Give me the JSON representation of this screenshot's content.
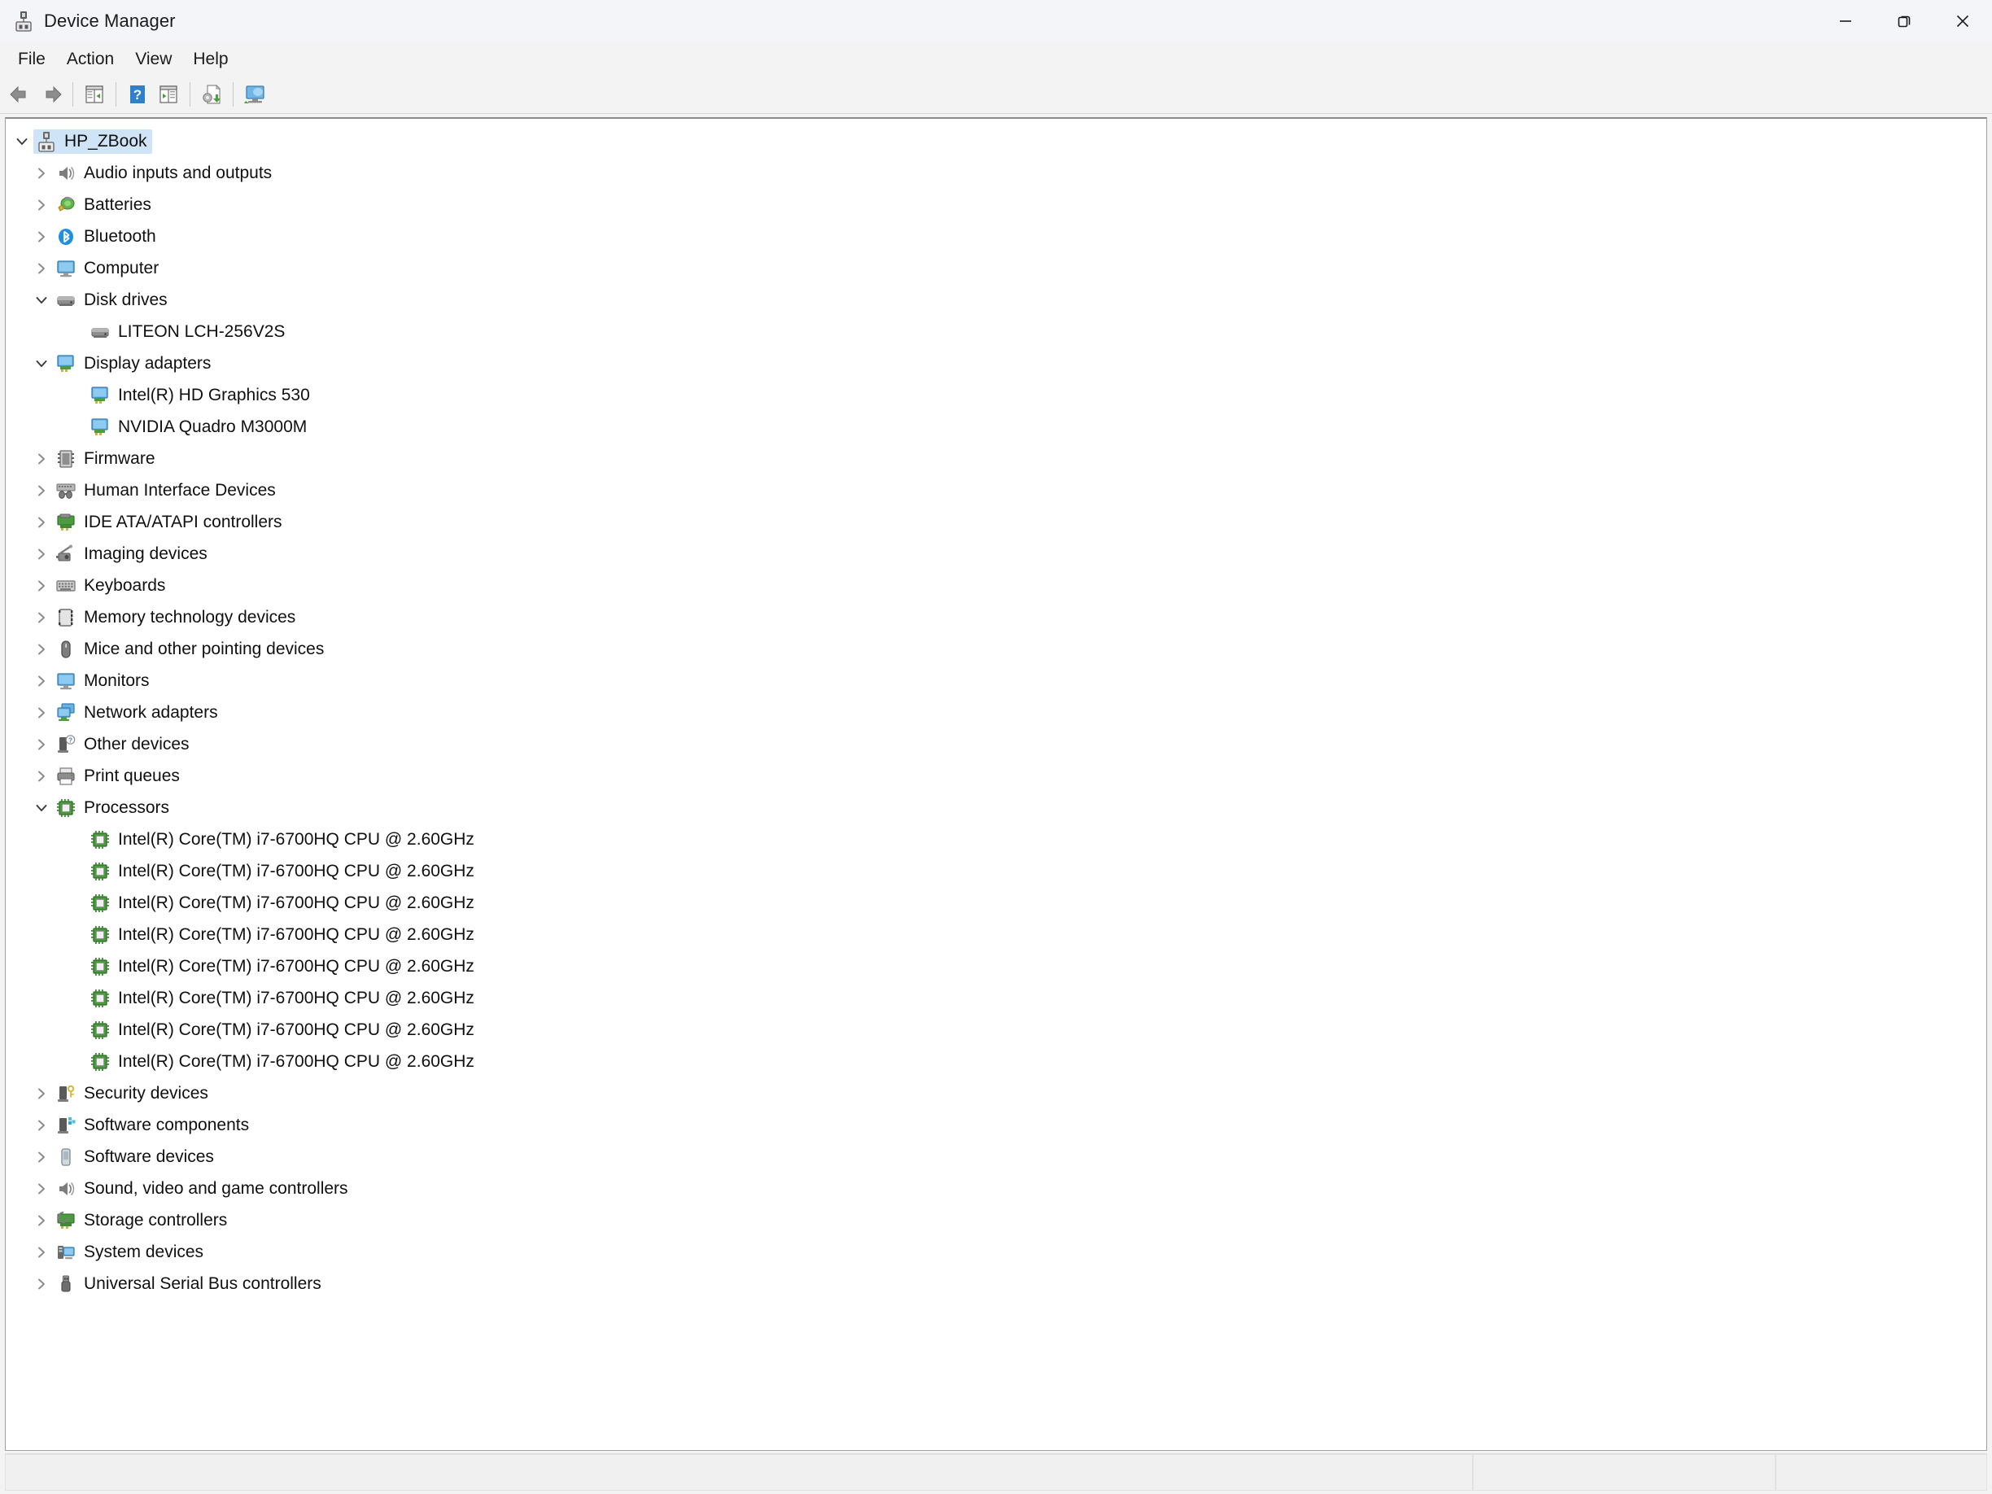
{
  "window": {
    "title": "Device Manager",
    "app_icon": "device-manager-icon",
    "controls": [
      {
        "name": "minimize",
        "glyph": "minimize-icon"
      },
      {
        "name": "restore",
        "glyph": "restore-icon"
      },
      {
        "name": "close",
        "glyph": "close-icon"
      }
    ]
  },
  "menubar": {
    "items": [
      {
        "label": "File",
        "name": "menu-file"
      },
      {
        "label": "Action",
        "name": "menu-action"
      },
      {
        "label": "View",
        "name": "menu-view"
      },
      {
        "label": "Help",
        "name": "menu-help"
      }
    ]
  },
  "toolbar": {
    "buttons": [
      {
        "name": "back-button",
        "icon": "back-arrow-icon"
      },
      {
        "name": "forward-button",
        "icon": "forward-arrow-icon"
      },
      {
        "name": "properties-button",
        "icon": "properties-panel-icon"
      },
      {
        "name": "help-button",
        "icon": "help-question-icon"
      },
      {
        "name": "show-hidden-devices-button",
        "icon": "panel-toggle-icon"
      },
      {
        "name": "update-driver-button",
        "icon": "update-driver-icon"
      },
      {
        "name": "scan-hardware-changes-button",
        "icon": "scan-monitor-icon"
      }
    ]
  },
  "tree": {
    "root": {
      "label": "HP_ZBook",
      "icon": "computer-root-icon",
      "expanded": true,
      "selected": true
    },
    "nodes": [
      {
        "label": "Audio inputs and outputs",
        "icon": "speaker-icon",
        "level": 1,
        "expanded": false,
        "has_children": true
      },
      {
        "label": "Batteries",
        "icon": "battery-icon",
        "level": 1,
        "expanded": false,
        "has_children": true
      },
      {
        "label": "Bluetooth",
        "icon": "bluetooth-icon",
        "level": 1,
        "expanded": false,
        "has_children": true
      },
      {
        "label": "Computer",
        "icon": "monitor-icon",
        "level": 1,
        "expanded": false,
        "has_children": true
      },
      {
        "label": "Disk drives",
        "icon": "disk-drive-icon",
        "level": 1,
        "expanded": true,
        "has_children": true
      },
      {
        "label": "LITEON LCH-256V2S",
        "icon": "disk-drive-icon",
        "level": 2,
        "expanded": false,
        "has_children": false
      },
      {
        "label": "Display adapters",
        "icon": "display-adapter-icon",
        "level": 1,
        "expanded": true,
        "has_children": true
      },
      {
        "label": "Intel(R) HD Graphics 530",
        "icon": "display-adapter-icon",
        "level": 2,
        "expanded": false,
        "has_children": false
      },
      {
        "label": "NVIDIA Quadro M3000M",
        "icon": "display-adapter-icon",
        "level": 2,
        "expanded": false,
        "has_children": false
      },
      {
        "label": "Firmware",
        "icon": "firmware-chip-icon",
        "level": 1,
        "expanded": false,
        "has_children": true
      },
      {
        "label": "Human Interface Devices",
        "icon": "hid-icon",
        "level": 1,
        "expanded": false,
        "has_children": true
      },
      {
        "label": "IDE ATA/ATAPI controllers",
        "icon": "ide-controller-icon",
        "level": 1,
        "expanded": false,
        "has_children": true
      },
      {
        "label": "Imaging devices",
        "icon": "imaging-camera-icon",
        "level": 1,
        "expanded": false,
        "has_children": true
      },
      {
        "label": "Keyboards",
        "icon": "keyboard-icon",
        "level": 1,
        "expanded": false,
        "has_children": true
      },
      {
        "label": "Memory technology devices",
        "icon": "memory-card-icon",
        "level": 1,
        "expanded": false,
        "has_children": true
      },
      {
        "label": "Mice and other pointing devices",
        "icon": "mouse-icon",
        "level": 1,
        "expanded": false,
        "has_children": true
      },
      {
        "label": "Monitors",
        "icon": "monitor-icon",
        "level": 1,
        "expanded": false,
        "has_children": true
      },
      {
        "label": "Network adapters",
        "icon": "network-adapter-icon",
        "level": 1,
        "expanded": false,
        "has_children": true
      },
      {
        "label": "Other devices",
        "icon": "other-device-question-icon",
        "level": 1,
        "expanded": false,
        "has_children": true
      },
      {
        "label": "Print queues",
        "icon": "printer-icon",
        "level": 1,
        "expanded": false,
        "has_children": true
      },
      {
        "label": "Processors",
        "icon": "processor-icon",
        "level": 1,
        "expanded": true,
        "has_children": true
      },
      {
        "label": "Intel(R) Core(TM) i7-6700HQ CPU @ 2.60GHz",
        "icon": "processor-icon",
        "level": 2,
        "expanded": false,
        "has_children": false
      },
      {
        "label": "Intel(R) Core(TM) i7-6700HQ CPU @ 2.60GHz",
        "icon": "processor-icon",
        "level": 2,
        "expanded": false,
        "has_children": false
      },
      {
        "label": "Intel(R) Core(TM) i7-6700HQ CPU @ 2.60GHz",
        "icon": "processor-icon",
        "level": 2,
        "expanded": false,
        "has_children": false
      },
      {
        "label": "Intel(R) Core(TM) i7-6700HQ CPU @ 2.60GHz",
        "icon": "processor-icon",
        "level": 2,
        "expanded": false,
        "has_children": false
      },
      {
        "label": "Intel(R) Core(TM) i7-6700HQ CPU @ 2.60GHz",
        "icon": "processor-icon",
        "level": 2,
        "expanded": false,
        "has_children": false
      },
      {
        "label": "Intel(R) Core(TM) i7-6700HQ CPU @ 2.60GHz",
        "icon": "processor-icon",
        "level": 2,
        "expanded": false,
        "has_children": false
      },
      {
        "label": "Intel(R) Core(TM) i7-6700HQ CPU @ 2.60GHz",
        "icon": "processor-icon",
        "level": 2,
        "expanded": false,
        "has_children": false
      },
      {
        "label": "Intel(R) Core(TM) i7-6700HQ CPU @ 2.60GHz",
        "icon": "processor-icon",
        "level": 2,
        "expanded": false,
        "has_children": false
      },
      {
        "label": "Security devices",
        "icon": "security-key-icon",
        "level": 1,
        "expanded": false,
        "has_children": true
      },
      {
        "label": "Software components",
        "icon": "software-component-icon",
        "level": 1,
        "expanded": false,
        "has_children": true
      },
      {
        "label": "Software devices",
        "icon": "software-device-icon",
        "level": 1,
        "expanded": false,
        "has_children": true
      },
      {
        "label": "Sound, video and game controllers",
        "icon": "speaker-icon",
        "level": 1,
        "expanded": false,
        "has_children": true
      },
      {
        "label": "Storage controllers",
        "icon": "storage-controller-icon",
        "level": 1,
        "expanded": false,
        "has_children": true
      },
      {
        "label": "System devices",
        "icon": "system-device-icon",
        "level": 1,
        "expanded": false,
        "has_children": true
      },
      {
        "label": "Universal Serial Bus controllers",
        "icon": "usb-icon",
        "level": 1,
        "expanded": false,
        "has_children": true
      }
    ]
  },
  "statusbar": {
    "panes": [
      "",
      "",
      ""
    ]
  },
  "colors": {
    "selection": "#cfe4f7",
    "titlebar": "#f3f5f9",
    "chrome": "#f3f3f3",
    "text": "#101010",
    "accent_blue": "#2f8ed6",
    "green": "#3f9c35"
  }
}
